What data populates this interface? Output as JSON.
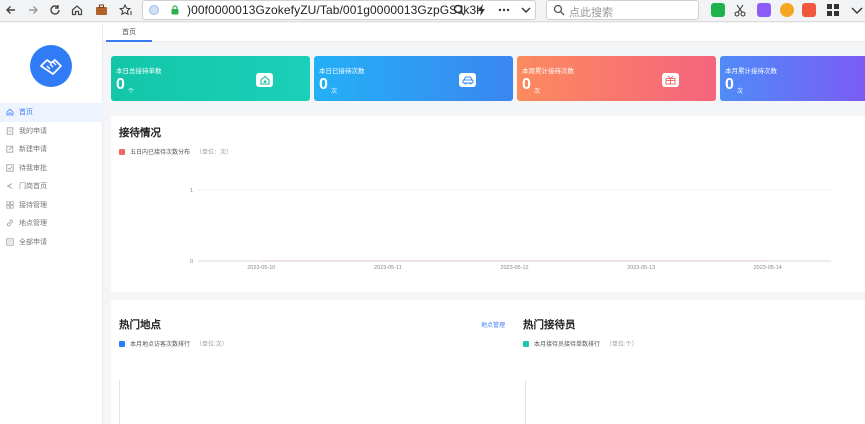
{
  "browser": {
    "url": ")00f0000013GzokefyZU/Tab/001g0000013GzpGSJk3h",
    "search_placeholder": "点此搜索"
  },
  "tabs": [
    {
      "label": "首页"
    }
  ],
  "sidebar": {
    "items": [
      {
        "label": "首页",
        "icon": "home-icon",
        "active": true
      },
      {
        "label": "我的申请",
        "icon": "document-icon"
      },
      {
        "label": "新建申请",
        "icon": "edit-icon"
      },
      {
        "label": "待我审批",
        "icon": "approve-icon"
      },
      {
        "label": "门岗首页",
        "icon": "gate-icon"
      },
      {
        "label": "接待管理",
        "icon": "grid-icon"
      },
      {
        "label": "地点管理",
        "icon": "link-icon"
      },
      {
        "label": "全部申请",
        "icon": "list-icon"
      }
    ]
  },
  "stats": [
    {
      "title": "本日总接待单数",
      "value": "0",
      "unit": "个",
      "icon": "home-badge-icon",
      "color_from": "#13c6a8",
      "color_to": "#1ad0b8"
    },
    {
      "title": "本日已接待次数",
      "value": "0",
      "unit": "次",
      "icon": "car-icon",
      "color_from": "#23b0f6",
      "color_to": "#3b86f0"
    },
    {
      "title": "本周累计接待次数",
      "value": "0",
      "unit": "次",
      "icon": "gift-icon",
      "color_from": "#fb8a5e",
      "color_to": "#f5647e"
    },
    {
      "title": "本月累计接待次数",
      "value": "0",
      "unit": "次",
      "icon": "",
      "color_from": "#4f8cf7",
      "color_to": "#7b5cf7"
    }
  ],
  "reception": {
    "title": "接待情况",
    "legend": "五日内已接待次数分布",
    "unit": "（单位：次）",
    "legend_color": "#f0686a"
  },
  "chart_data": {
    "type": "line",
    "categories": [
      "2023-05-10",
      "2023-05-11",
      "2023-05-12",
      "2023-05-13",
      "2023-05-14"
    ],
    "series": [
      {
        "values": [
          0,
          0,
          0,
          0,
          0
        ]
      }
    ],
    "yticks": [
      0,
      1
    ],
    "ylim": [
      0,
      1
    ],
    "grid": true
  },
  "hot_places": {
    "title": "热门地点",
    "link": "地点管理",
    "legend": "本月地点访客次数排行",
    "unit": "（单位:次）",
    "legend_color": "#2f7cf6"
  },
  "hot_receptionists": {
    "title": "热门接待员",
    "legend": "本月接待员接待单数排行",
    "unit": "（单位:个）",
    "legend_color": "#1cc7b5"
  }
}
